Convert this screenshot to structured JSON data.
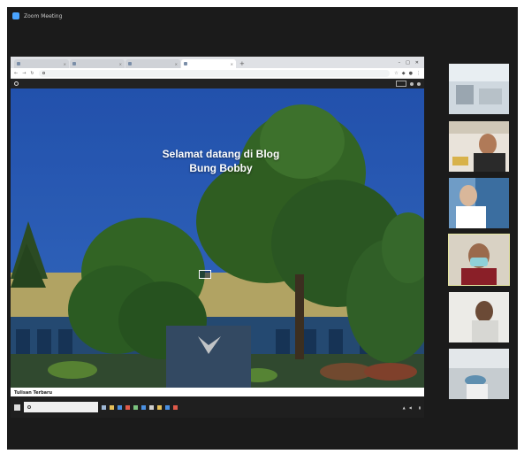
{
  "app": {
    "title": "Zoom Meeting"
  },
  "browser": {
    "tabs": [
      {
        "label": ""
      },
      {
        "label": ""
      },
      {
        "label": ""
      },
      {
        "label": ""
      }
    ],
    "new_tab_glyph": "+",
    "url": "",
    "win_controls": [
      "–",
      "□",
      "✕"
    ]
  },
  "site": {
    "bar_items": [
      "",
      ""
    ],
    "center_text": "",
    "hero_title": "Selamat datang di Blog Bung Bobby",
    "hero_lines": [
      "",
      "",
      "",
      "",
      "",
      "",
      ""
    ],
    "cta_label": "",
    "sign_text": "",
    "section_title": "Tulisan Terbaru"
  },
  "taskbar": {
    "search_placeholder": "",
    "clock_time": "",
    "clock_date": ""
  },
  "participants": [
    {
      "name": "",
      "active": false
    },
    {
      "name": "",
      "active": false
    },
    {
      "name": "",
      "active": false
    },
    {
      "name": "",
      "active": true
    },
    {
      "name": "",
      "active": false
    },
    {
      "name": "",
      "active": false
    }
  ],
  "colors": {
    "sky": "#2f6ad9",
    "foliage": "#3f7a2e",
    "building": "#d8c779",
    "meeting_bg": "#1b1b1b"
  }
}
